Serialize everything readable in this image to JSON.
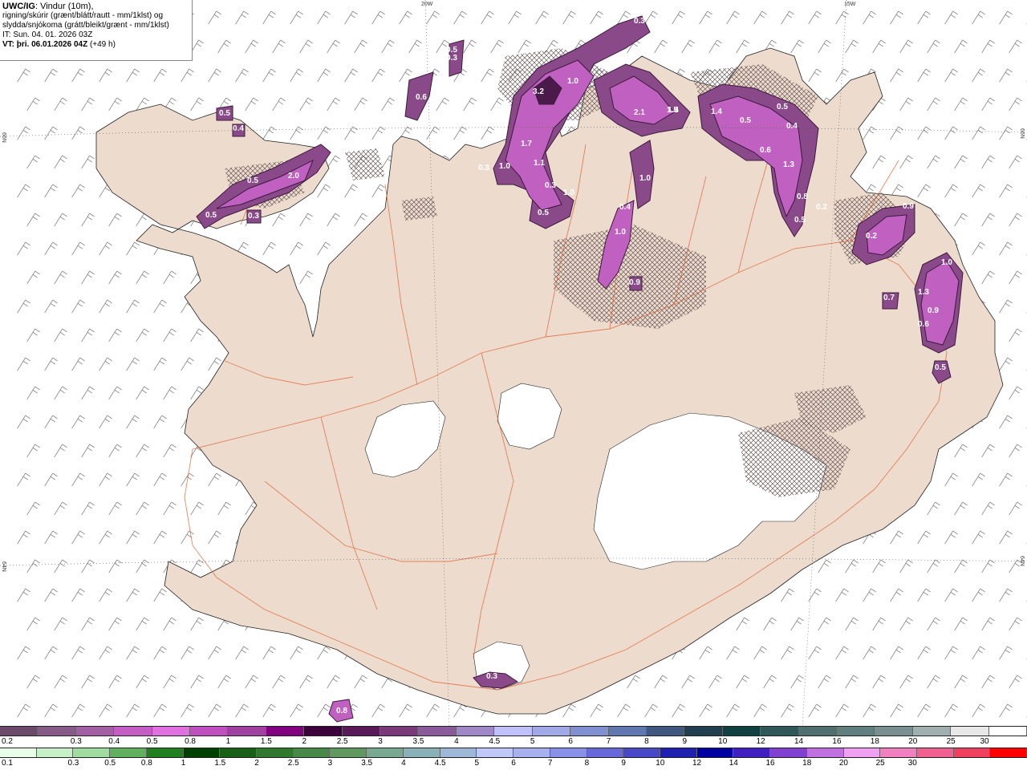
{
  "info": {
    "line1_bold": "UWC/IG",
    "line1_rest": ": Vindur (10m),",
    "line2": "rigning/skúrir (grænt/blátt/rautt - mm/1klst) og",
    "line3": "slydda/snjókoma (grátt/bleikt/grænt - mm/1klst)",
    "line4": "IT: Sun. 04. 01. 2026 03Z",
    "line5_bold": "VT: þri. 06.01.2026 04Z",
    "line5_rest": " (+49 h)"
  },
  "grid_labels": {
    "lon_20w": "20W",
    "lon_15w": "15W",
    "lat_66n_left": "66N",
    "lat_66n_right": "66N",
    "lat_64n_left": "64N",
    "lat_64n_right": "64N"
  },
  "precip_values": [
    {
      "label": "0.3"
    },
    {
      "label": "0.3"
    },
    {
      "label": "0.5"
    },
    {
      "label": "0.6"
    },
    {
      "label": "0.6"
    },
    {
      "label": "1.0"
    },
    {
      "label": "3.2"
    },
    {
      "label": "1.4"
    },
    {
      "label": "2.1"
    },
    {
      "label": "1.5"
    },
    {
      "label": "1.4"
    },
    {
      "label": "0.5"
    },
    {
      "label": "0.5"
    },
    {
      "label": "0.4"
    },
    {
      "label": "0.6"
    },
    {
      "label": "1.3"
    },
    {
      "label": "0.8"
    },
    {
      "label": "0.5"
    },
    {
      "label": "0.2"
    },
    {
      "label": "0.5"
    },
    {
      "label": "0.4"
    },
    {
      "label": "0.5"
    },
    {
      "label": "2.0"
    },
    {
      "label": "0.5"
    },
    {
      "label": "0.3"
    },
    {
      "label": "1.7"
    },
    {
      "label": "1.1"
    },
    {
      "label": "0.3"
    },
    {
      "label": "1.0"
    },
    {
      "label": "0.3"
    },
    {
      "label": "1.0"
    },
    {
      "label": "0.5"
    },
    {
      "label": "1.0"
    },
    {
      "label": "0.4"
    },
    {
      "label": "1.0"
    },
    {
      "label": "0.9"
    },
    {
      "label": "0.2"
    },
    {
      "label": "0.9"
    },
    {
      "label": "1.0"
    },
    {
      "label": "1.3"
    },
    {
      "label": "0.9"
    },
    {
      "label": "0.6"
    },
    {
      "label": "0.7"
    },
    {
      "label": "0.5"
    },
    {
      "label": "0.3"
    },
    {
      "label": "0.8"
    },
    {
      "label": "1.8"
    }
  ],
  "legend_snow": {
    "colors": [
      "#6b4a6b",
      "#875a87",
      "#a35fa3",
      "#c45ec4",
      "#e070e0",
      "#c050c0",
      "#a040a0",
      "#800080",
      "#3c003c",
      "#5a1a5a",
      "#7a3a7a",
      "#8a5a9a",
      "#a088c8",
      "#c0c0ff",
      "#a0a8e8",
      "#8090d0",
      "#6078b0",
      "#405880",
      "#204050",
      "#104040",
      "#305858",
      "#507070",
      "#608080",
      "#7a9090",
      "#a0b0b0",
      "#e8e8e8",
      "#ffffff"
    ],
    "labels": [
      "0.2",
      "0.3",
      "0.4",
      "0.5",
      "0.8",
      "1",
      "1.5",
      "2",
      "2.5",
      "3",
      "3.5",
      "4",
      "4.5",
      "5",
      "6",
      "7",
      "8",
      "9",
      "10",
      "12",
      "14",
      "16",
      "18",
      "20",
      "25",
      "30"
    ]
  },
  "legend_rain": {
    "colors": [
      "#e8ffe8",
      "#c8f0c8",
      "#a0dca0",
      "#60b060",
      "#208020",
      "#004000",
      "#186018",
      "#307830",
      "#488848",
      "#609860",
      "#78a890",
      "#8ab0b8",
      "#a0b8d8",
      "#c0c8f8",
      "#a8b0f0",
      "#8890e8",
      "#6868d8",
      "#4848c8",
      "#2020b0",
      "#0000a0",
      "#4020c0",
      "#8040d0",
      "#c070e0",
      "#f0a0f0",
      "#f080c0",
      "#f06090",
      "#f04060",
      "#ff0000"
    ],
    "labels": [
      "0.1",
      "0.3",
      "0.5",
      "0.8",
      "1",
      "1.5",
      "2",
      "2.5",
      "3",
      "3.5",
      "4",
      "4.5",
      "5",
      "6",
      "7",
      "8",
      "9",
      "10",
      "12",
      "14",
      "16",
      "18",
      "20",
      "25",
      "30"
    ]
  }
}
